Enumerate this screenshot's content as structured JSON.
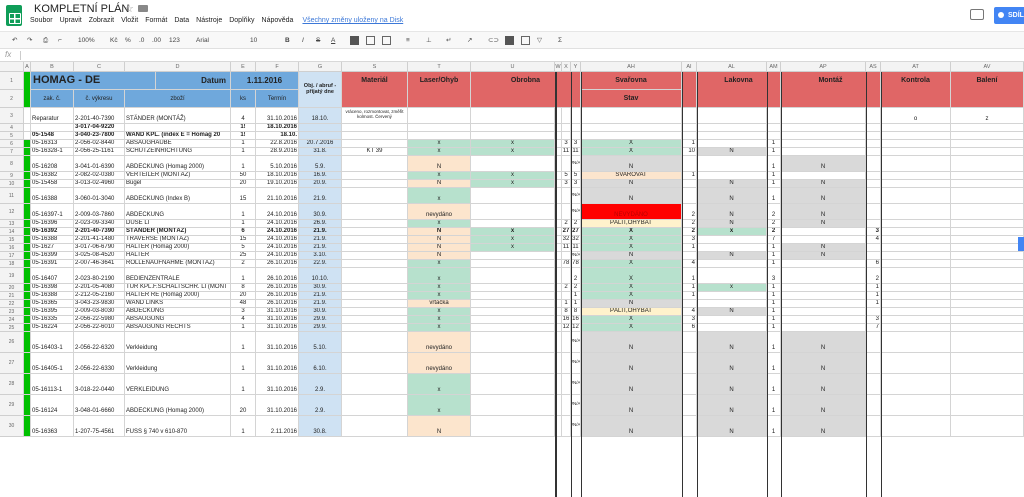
{
  "app": {
    "title": "KOMPLETNÍ PLÁN",
    "menu": [
      "Soubor",
      "Upravit",
      "Zobrazit",
      "Vložit",
      "Formát",
      "Data",
      "Nástroje",
      "Doplňky",
      "Nápověda"
    ],
    "saved_status": "Všechny změny uloženy na Disk",
    "share_label": "SDÍL"
  },
  "toolbar": {
    "zoom": "100%",
    "currency": "Kč",
    "percent": "%",
    "dec_less": ".0",
    "dec_more": ".00",
    "more_formats": "123",
    "font": "Arial",
    "font_size": "10",
    "bold": "B",
    "italic": "I",
    "strike": "S",
    "text_color": "A",
    "sum": "Σ"
  },
  "formula_bar": {
    "fx": "fx",
    "content": ""
  },
  "column_headers": [
    "A",
    "B",
    "C",
    "D",
    "E",
    "F",
    "G",
    "S",
    "T",
    "U",
    "W",
    "X",
    "Y",
    "AH",
    "AI",
    "AL",
    "AM",
    "AP",
    "AS",
    "AT",
    "AV"
  ],
  "header": {
    "title": "HOMAG - DE",
    "datum_label": "Datum",
    "datum_value": "1.11.2016",
    "obj": "Obj. / abruf - přijatý dne",
    "material": "Materiál",
    "laser": "Laser/Ohyb",
    "obrobna": "Obrobna",
    "svarovna": "Svařovna",
    "stav": "Stav",
    "lakovna": "Lakovna",
    "montaz": "Montáž",
    "kontrola": "Kontrola",
    "baleni": "Balení",
    "zak": "zak. č.",
    "vykres": "č. výkresu",
    "zbozi": "zboží",
    "ks": "ks",
    "termin": "Termín"
  },
  "rows": [
    {
      "n": "3",
      "zak": "Reparatur",
      "vyk": "2-201-40-7390",
      "zb": "STÄNDER (MONTÁŽ)",
      "ks": "4",
      "term": "31.10.2016",
      "obj": "18.10.",
      "mat": "vráceno, rozmontovat, změřit kolmost. Červený",
      "las": "",
      "obr": "",
      "o1": "",
      "o2": "",
      "sv": "",
      "s2": "",
      "lak": "",
      "l2": "",
      "mon": "",
      "m2": "",
      "kon": "o",
      "bal": "z",
      "h": 16
    },
    {
      "n": "4",
      "zak": "",
      "vyk": "3-017-04-9220",
      "zb": "",
      "ks": "1!",
      "term": "18.10.2016",
      "obj": "",
      "mat": "",
      "las": "",
      "obr": "",
      "o1": "",
      "o2": "",
      "sv": "",
      "s2": "",
      "lak": "",
      "l2": "",
      "mon": "",
      "m2": "",
      "kon": "",
      "bal": "",
      "h": 8,
      "bold": true
    },
    {
      "n": "5",
      "zak": "05-1548",
      "vyk": "3-040-23-7800",
      "zb": "WAND KPL. (index E = Homag 20",
      "ks": "1!",
      "term": "18.10.",
      "obj": "",
      "mat": "",
      "las": "",
      "obr": "",
      "o1": "",
      "o2": "",
      "sv": "",
      "s2": "",
      "lak": "",
      "l2": "",
      "mon": "",
      "m2": "",
      "kon": "",
      "bal": "",
      "h": 8,
      "bold": true
    },
    {
      "n": "6",
      "zak": "05-16313",
      "vyk": "2-056-02-8440",
      "zb": "ABSAUGHAUBE",
      "ks": "1",
      "term": "22.8.2016",
      "obj": "20.7.2016",
      "mat": "",
      "las": "x",
      "obr": "x",
      "o1": "3",
      "o2": "3",
      "sv": "X",
      "s2": "1",
      "lak": "",
      "l2": "1",
      "mon": "",
      "m2": "",
      "kon": "",
      "bal": "",
      "h": 8
    },
    {
      "n": "7",
      "zak": "05-16328-1",
      "vyk": "2-056-25-1161",
      "zb": "SCHUTZEINRICHTUNG",
      "ks": "1",
      "term": "28.9.2016",
      "obj": "31.8.",
      "mat": "KT 39",
      "las": "x",
      "obr": "x",
      "o1": "11",
      "o2": "11",
      "sv": "X",
      "s2": "10",
      "lak": "N",
      "l2": "1",
      "mon": "",
      "m2": "",
      "kon": "",
      "bal": "",
      "h": 8
    },
    {
      "n": "8",
      "zak": "05-16208",
      "vyk": "3-041-01-6390",
      "zb": "ABDECKUNG (Homag 2000)",
      "ks": "1",
      "term": "5.10.2016",
      "obj": "5.9.",
      "mat": "",
      "las": "N",
      "obr": "",
      "o1": "",
      "o2": "#N/A",
      "sv": "N",
      "s2": "",
      "lak": "",
      "l2": "1",
      "mon": "N",
      "m2": "",
      "kon": "",
      "bal": "",
      "h": 16
    },
    {
      "n": "9",
      "zak": "05-16382",
      "vyk": "2-082-02-0380",
      "zb": "VERTEILER (MONTÁŽ)",
      "ks": "50",
      "term": "18.10.2016",
      "obj": "16.9.",
      "mat": "",
      "las": "x",
      "obr": "x",
      "o1": "5",
      "o2": "5",
      "sv": "SVAŘOVAT",
      "s2": "1",
      "lak": "",
      "l2": "1",
      "mon": "",
      "m2": "",
      "kon": "",
      "bal": "",
      "h": 8
    },
    {
      "n": "10",
      "zak": "05-15458",
      "vyk": "3-013-02-4960",
      "zb": "Bügel",
      "ks": "20",
      "term": "19.10.2016",
      "obj": "20.9.",
      "mat": "",
      "las": "N",
      "obr": "x",
      "o1": "3",
      "o2": "3",
      "sv": "N",
      "s2": "",
      "lak": "N",
      "l2": "1",
      "mon": "N",
      "m2": "",
      "kon": "",
      "bal": "",
      "h": 8
    },
    {
      "n": "11",
      "zak": "05-16388",
      "vyk": "3-060-01-3040",
      "zb": "ABDECKUNG (Index B)",
      "ks": "15",
      "term": "21.10.2016",
      "obj": "21.9.",
      "mat": "",
      "las": "x",
      "obr": "",
      "o1": "",
      "o2": "#N/A",
      "sv": "N",
      "s2": "",
      "lak": "N",
      "l2": "1",
      "mon": "N",
      "m2": "",
      "kon": "",
      "bal": "",
      "h": 16
    },
    {
      "n": "12",
      "zak": "05-16397-1",
      "vyk": "2-009-03-7860",
      "zb": "ABDECKUNG",
      "ks": "1",
      "term": "24.10.2016",
      "obj": "30.9.",
      "mat": "",
      "las": "nevydáno",
      "obr": "",
      "o1": "",
      "o2": "#N/A",
      "sv": "NEVYDÁNO",
      "s2": "2",
      "lak": "N",
      "l2": "2",
      "mon": "N",
      "m2": "",
      "kon": "",
      "bal": "",
      "h": 16,
      "red": true
    },
    {
      "n": "13",
      "zak": "05-16396",
      "vyk": "2-023-09-3340",
      "zb": "DÜSE LI",
      "ks": "1",
      "term": "24.10.2016",
      "obj": "26.9.",
      "mat": "",
      "las": "x",
      "obr": "",
      "o1": "2",
      "o2": "2",
      "sv": "PÁLIT,OHÝBAT",
      "s2": "2",
      "lak": "N",
      "l2": "2",
      "mon": "N",
      "m2": "",
      "kon": "",
      "bal": "",
      "h": 8
    },
    {
      "n": "14",
      "zak": "05-16392",
      "vyk": "2-201-40-7390",
      "zb": "STÄNDER (MONTÁŽ)",
      "ks": "6",
      "term": "24.10.2016",
      "obj": "21.9.",
      "mat": "",
      "las": "N",
      "obr": "x",
      "o1": "27",
      "o2": "27",
      "sv": "X",
      "s2": "2",
      "lak": "x",
      "l2": "2",
      "mon": "",
      "m2": "3",
      "kon": "",
      "bal": "",
      "h": 8,
      "bold": true
    },
    {
      "n": "15",
      "zak": "05-16388",
      "vyk": "2-201-41-1480",
      "zb": "TRAVERSE (MONTÁŽ)",
      "ks": "15",
      "term": "24.10.2016",
      "obj": "21.9.",
      "mat": "",
      "las": "N",
      "obr": "x",
      "o1": "32",
      "o2": "32",
      "sv": "X",
      "s2": "3",
      "lak": "",
      "l2": "7",
      "mon": "",
      "m2": "4",
      "kon": "",
      "bal": "",
      "h": 8
    },
    {
      "n": "16",
      "zak": "05-1627",
      "vyk": "3-017-06-6790",
      "zb": "HALTER (Homag 2000)",
      "ks": "5",
      "term": "24.10.2016",
      "obj": "21.9.",
      "mat": "",
      "las": "N",
      "obr": "x",
      "o1": "11",
      "o2": "11",
      "sv": "X",
      "s2": "1",
      "lak": "",
      "l2": "1",
      "mon": "N",
      "m2": "",
      "kon": "",
      "bal": "",
      "h": 8
    },
    {
      "n": "17",
      "zak": "05-16399",
      "vyk": "3-025-08-4520",
      "zb": "HALTER",
      "ks": "25",
      "term": "24.10.2016",
      "obj": "3.10.",
      "mat": "",
      "las": "N",
      "obr": "",
      "o1": "",
      "o2": "#N/A",
      "sv": "N",
      "s2": "",
      "lak": "N",
      "l2": "1",
      "mon": "N",
      "m2": "",
      "kon": "",
      "bal": "",
      "h": 8
    },
    {
      "n": "18",
      "zak": "05-16391",
      "vyk": "2-007-46-3641",
      "zb": "ROLLENAUFNAHME (MONTÁŽ)",
      "ks": "2",
      "term": "26.10.2016",
      "obj": "22.9.",
      "mat": "",
      "las": "x",
      "obr": "",
      "o1": "78",
      "o2": "78",
      "sv": "X",
      "s2": "4",
      "lak": "",
      "l2": "1",
      "mon": "",
      "m2": "6",
      "kon": "",
      "bal": "",
      "h": 8
    },
    {
      "n": "19",
      "zak": "05-16407",
      "vyk": "2-023-80-2190",
      "zb": "BEDIENZENTRALE",
      "ks": "1",
      "term": "26.10.2016",
      "obj": "10.10.",
      "mat": "",
      "las": "x",
      "obr": "",
      "o1": "",
      "o2": "2",
      "sv": "X",
      "s2": "1",
      "lak": "",
      "l2": "3",
      "mon": "",
      "m2": "2",
      "kon": "",
      "bal": "",
      "h": 16
    },
    {
      "n": "20",
      "zak": "05-16398",
      "vyk": "2-201-05-4080",
      "zb": "TÜR KPL.F.SCHALTSCHR. LI (MONT",
      "ks": "8",
      "term": "26.10.2016",
      "obj": "30.9.",
      "mat": "",
      "las": "x",
      "obr": "",
      "o1": "2",
      "o2": "2",
      "sv": "X",
      "s2": "1",
      "lak": "x",
      "l2": "1",
      "mon": "",
      "m2": "1",
      "kon": "",
      "bal": "",
      "h": 8
    },
    {
      "n": "21",
      "zak": "05-16388",
      "vyk": "2-212-05-2160",
      "zb": "HALTER RE (Homag 2000)",
      "ks": "20",
      "term": "26.10.2016",
      "obj": "21.9.",
      "mat": "",
      "las": "x",
      "obr": "",
      "o1": "",
      "o2": "1",
      "sv": "X",
      "s2": "1",
      "lak": "",
      "l2": "1",
      "mon": "",
      "m2": "1",
      "kon": "",
      "bal": "",
      "h": 8
    },
    {
      "n": "22",
      "zak": "05-16365",
      "vyk": "3-043-23-9830",
      "zb": "WAND LINKS",
      "ks": "48",
      "term": "26.10.2016",
      "obj": "21.9.",
      "mat": "",
      "las": "vrtačka",
      "obr": "",
      "o1": "1",
      "o2": "1",
      "sv": "N",
      "s2": "",
      "lak": "",
      "l2": "1",
      "mon": "",
      "m2": "1",
      "kon": "",
      "bal": "",
      "h": 8
    },
    {
      "n": "23",
      "zak": "05-16395",
      "vyk": "2-009-03-8030",
      "zb": "ABDECKUNG",
      "ks": "3",
      "term": "31.10.2016",
      "obj": "30.9.",
      "mat": "",
      "las": "x",
      "obr": "",
      "o1": "8",
      "o2": "8",
      "sv": "PÁLIT,OHÝBAT",
      "s2": "4",
      "lak": "N",
      "l2": "1",
      "mon": "",
      "m2": "",
      "kon": "",
      "bal": "",
      "h": 8
    },
    {
      "n": "24",
      "zak": "05-16335",
      "vyk": "2-056-22-5980",
      "zb": "ABSAUGUNG",
      "ks": "4",
      "term": "31.10.2016",
      "obj": "29.9.",
      "mat": "",
      "las": "x",
      "obr": "",
      "o1": "16",
      "o2": "16",
      "sv": "X",
      "s2": "3",
      "lak": "",
      "l2": "1",
      "mon": "",
      "m2": "3",
      "kon": "",
      "bal": "",
      "h": 8
    },
    {
      "n": "25",
      "zak": "05-16224",
      "vyk": "2-056-22-6010",
      "zb": "ABSAUGUNG RECHTS",
      "ks": "1",
      "term": "31.10.2016",
      "obj": "29.9.",
      "mat": "",
      "las": "x",
      "obr": "",
      "o1": "12",
      "o2": "12",
      "sv": "X",
      "s2": "6",
      "lak": "",
      "l2": "1",
      "mon": "",
      "m2": "7",
      "kon": "",
      "bal": "",
      "h": 8
    },
    {
      "n": "26",
      "zak": "05-16403-1",
      "vyk": "2-056-22-6320",
      "zb": "Verkleidung",
      "ks": "1",
      "term": "31.10.2016",
      "obj": "5.10.",
      "mat": "",
      "las": "nevydáno",
      "obr": "",
      "o1": "",
      "o2": "#N/A",
      "sv": "N",
      "s2": "",
      "lak": "N",
      "l2": "1",
      "mon": "N",
      "m2": "",
      "kon": "",
      "bal": "",
      "h": 21
    },
    {
      "n": "27",
      "zak": "05-16405-1",
      "vyk": "2-056-22-6330",
      "zb": "Verkleidung",
      "ks": "1",
      "term": "31.10.2016",
      "obj": "6.10.",
      "mat": "",
      "las": "nevydáno",
      "obr": "",
      "o1": "",
      "o2": "#N/A",
      "sv": "N",
      "s2": "",
      "lak": "N",
      "l2": "1",
      "mon": "N",
      "m2": "",
      "kon": "",
      "bal": "",
      "h": 21
    },
    {
      "n": "28",
      "zak": "05-16113-1",
      "vyk": "3-018-22-0440",
      "zb": "VERKLEIDUNG",
      "ks": "1",
      "term": "31.10.2016",
      "obj": "2.9.",
      "mat": "",
      "las": "x",
      "obr": "",
      "o1": "",
      "o2": "#N/A",
      "sv": "N",
      "s2": "",
      "lak": "N",
      "l2": "1",
      "mon": "N",
      "m2": "",
      "kon": "",
      "bal": "",
      "h": 21
    },
    {
      "n": "29",
      "zak": "05-16124",
      "vyk": "3-048-01-6660",
      "zb": "ABDECKUNG (Homag 2000)",
      "ks": "20",
      "term": "31.10.2016",
      "obj": "2.9.",
      "mat": "",
      "las": "x",
      "obr": "",
      "o1": "",
      "o2": "#N/A",
      "sv": "N",
      "s2": "",
      "lak": "N",
      "l2": "1",
      "mon": "N",
      "m2": "",
      "kon": "",
      "bal": "",
      "h": 21
    },
    {
      "n": "30",
      "zak": "05-16363",
      "vyk": "1-207-75-4561",
      "zb": "FUSS § 740 v 610-870",
      "ks": "1",
      "term": "2.11.2016",
      "obj": "30.8.",
      "mat": "",
      "las": "N",
      "obr": "",
      "o1": "",
      "o2": "#N/A",
      "sv": "N",
      "s2": "",
      "lak": "N",
      "l2": "1",
      "mon": "N",
      "m2": "",
      "kon": "",
      "bal": "",
      "h": 21
    }
  ],
  "colors": {
    "blue_header": "#6fa8dc",
    "light_blue": "#cfe2f3",
    "red_header": "#e06666",
    "green_cell": "#b7e1cd",
    "orange_cell": "#fce5cd",
    "gray_cell": "#d9d9d9",
    "red_cell": "#ff0000",
    "yellow_cell": "#fff2cc",
    "row_green": "#00c000"
  }
}
